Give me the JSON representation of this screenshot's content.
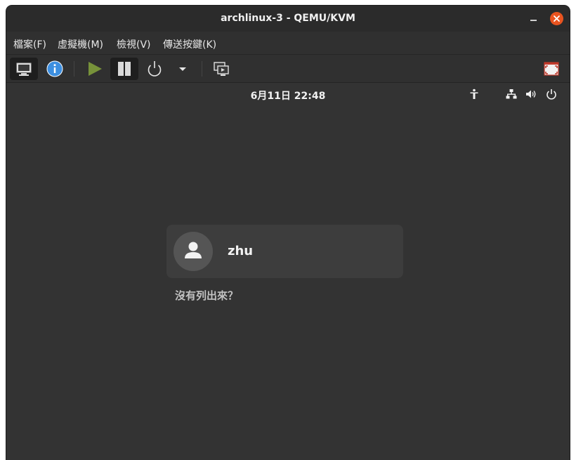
{
  "window": {
    "title": "archlinux-3 - QEMU/KVM"
  },
  "menubar": {
    "items": [
      {
        "label": "檔案(F)"
      },
      {
        "label": "虛擬機(M)"
      },
      {
        "label": "檢視(V)"
      },
      {
        "label": "傳送按鍵(K)"
      }
    ]
  },
  "toolbar": {
    "buttons": [
      {
        "icon": "monitor-icon",
        "state": "active"
      },
      {
        "icon": "info-icon"
      },
      {
        "icon": "play-icon"
      },
      {
        "icon": "pause-icon",
        "state": "active"
      },
      {
        "icon": "power-icon"
      },
      {
        "icon": "dropdown-arrow-icon"
      },
      {
        "icon": "snapshot-screens-icon"
      },
      {
        "icon": "fullscreen-icon"
      }
    ],
    "colors": {
      "info": "#3d8fe0",
      "play": "#77923a",
      "fullscreen": "#c0392b"
    }
  },
  "guest": {
    "clock": "6月11日 22:48",
    "panel_icons": [
      "accessibility-icon",
      "network-icon",
      "volume-icon",
      "power-icon"
    ],
    "user": {
      "name": "zhu"
    },
    "not_listed": "沒有列出來？"
  },
  "colors": {
    "close_button": "#e95420",
    "background": "#333333"
  }
}
